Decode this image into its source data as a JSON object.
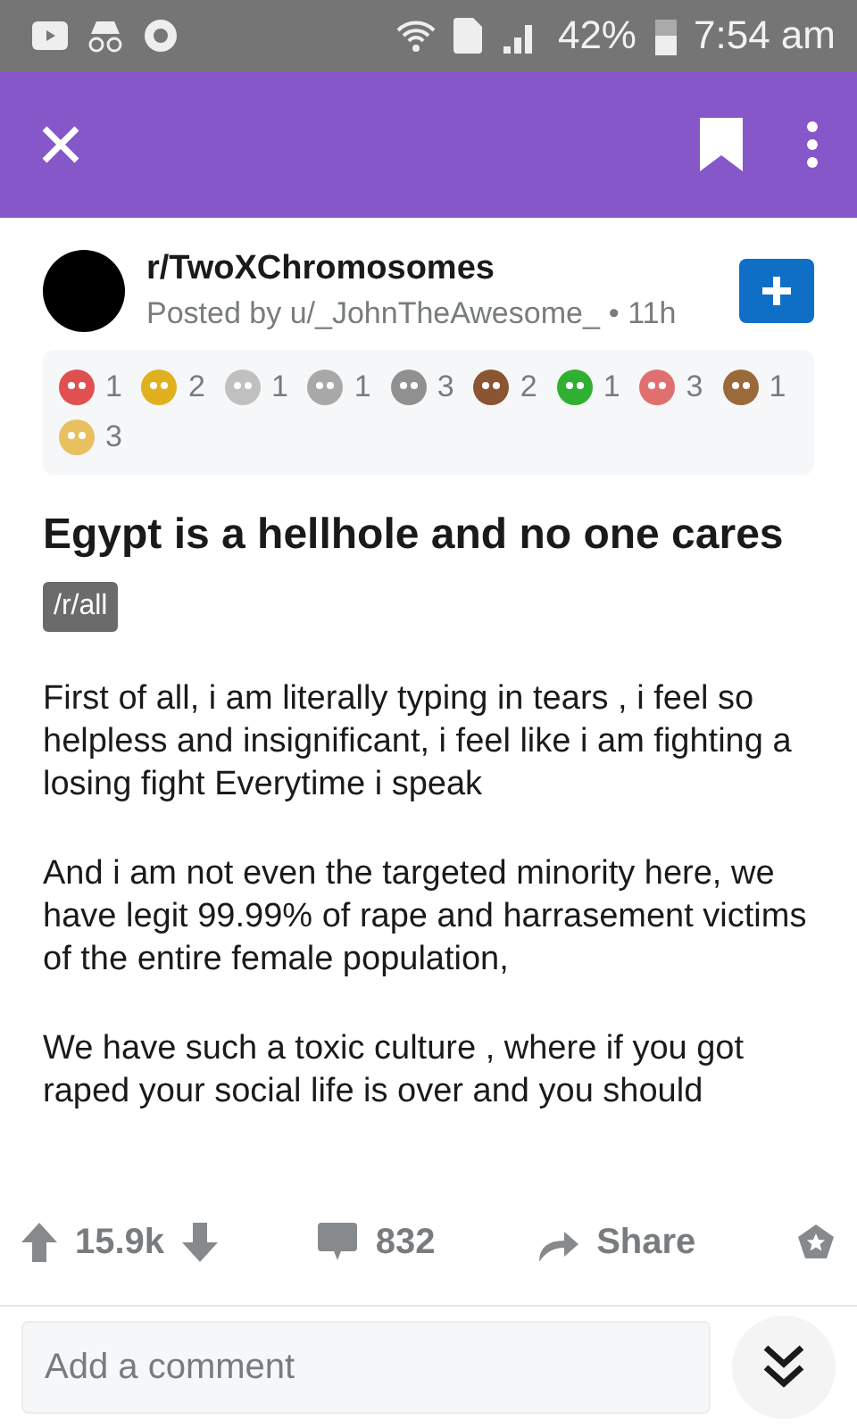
{
  "status_bar": {
    "battery": "42%",
    "time": "7:54 am"
  },
  "post": {
    "subreddit": "r/TwoXChromosomes",
    "byline": "Posted by u/_JohnTheAwesome_",
    "age": "• 11h",
    "awards": [
      {
        "count": "1",
        "color": "#e05050"
      },
      {
        "count": "2",
        "color": "#e0b020"
      },
      {
        "count": "1",
        "color": "#c0c0c0"
      },
      {
        "count": "1",
        "color": "#a8a8a8"
      },
      {
        "count": "3",
        "color": "#909090"
      },
      {
        "count": "2",
        "color": "#8a5530"
      },
      {
        "count": "1",
        "color": "#30b030"
      },
      {
        "count": "3",
        "color": "#e07070"
      },
      {
        "count": "1",
        "color": "#9a6a3a"
      },
      {
        "count": "3",
        "color": "#e8c060"
      }
    ],
    "title": "Egypt is a hellhole and no one cares",
    "flair": "/r/all",
    "paragraphs": [
      "First of all, i am literally typing in tears , i feel so helpless and insignificant, i feel like i am fighting a losing fight Everytime i speak",
      "And i am not even the targeted minority here, we have legit 99.99% of rape and harrasement victims of the entire female population,",
      "We have such a toxic culture , where if you got raped your social life is over and you should"
    ]
  },
  "actions": {
    "score": "15.9k",
    "comments": "832",
    "share": "Share"
  },
  "comment_field": {
    "placeholder": "Add a comment"
  }
}
